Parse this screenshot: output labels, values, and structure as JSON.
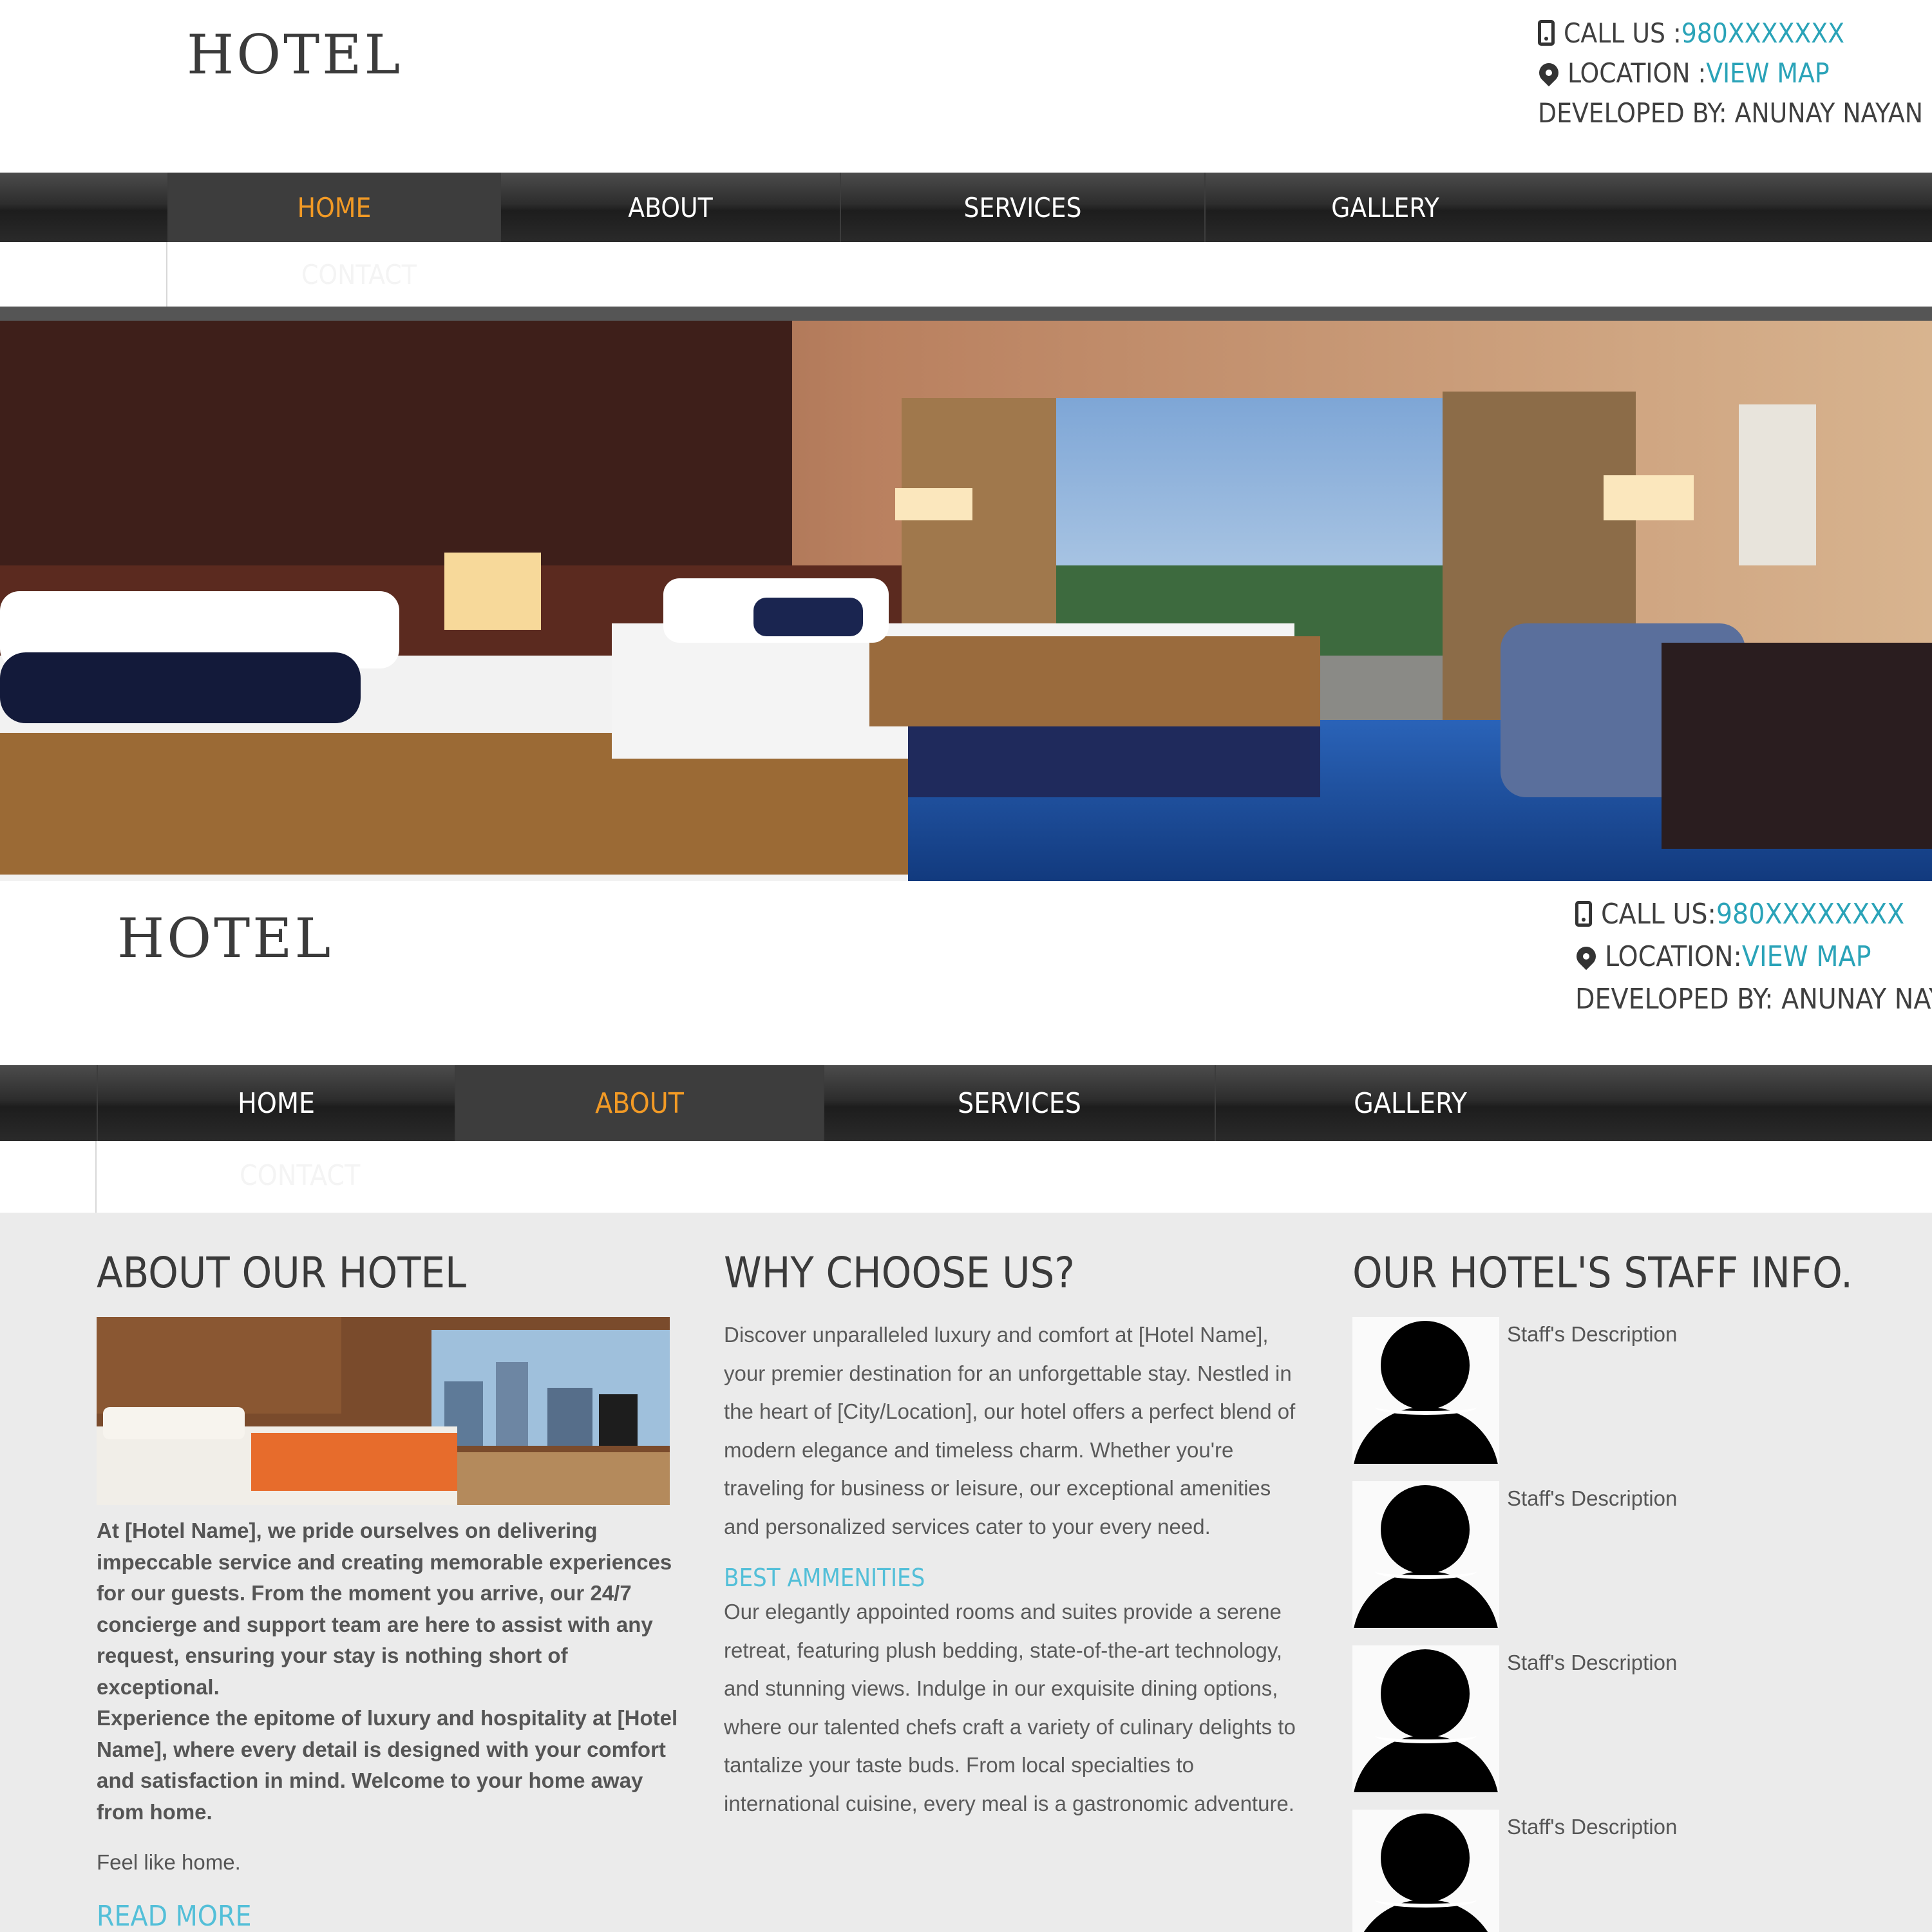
{
  "header": {
    "logo": "HOTEL",
    "call_label": "CALL US : ",
    "call_number": "980XXXXXXX",
    "location_label": "LOCATION : ",
    "location_link": "VIEW MAP",
    "developer": "DEVELOPED BY: ANUNAY NAYAN"
  },
  "header2": {
    "logo": "HOTEL",
    "call_label": "CALL US: ",
    "call_number": "980XXXXXXXX",
    "location_label": "LOCATION: ",
    "location_link": "VIEW MAP",
    "developer": "DEVELOPED BY: ANUNAY NAYAN"
  },
  "nav": {
    "items": [
      "HOME",
      "ABOUT",
      "SERVICES",
      "GALLERY"
    ],
    "overflow_item": "CONTACT",
    "active_first": "HOME",
    "active_second": "ABOUT"
  },
  "about": {
    "title": "ABOUT OUR HOTEL",
    "paragraph1": "At [Hotel Name], we pride ourselves on delivering impeccable service and creating memorable experiences for our guests. From the moment you arrive, our 24/7 concierge and support team are here to assist with any request, ensuring your stay is nothing short of exceptional.",
    "paragraph2": "Experience the epitome of luxury and hospitality at [Hotel Name], where every detail is designed with your comfort and satisfaction in mind. Welcome to your home away from home.",
    "tagline": "Feel like home.",
    "read_more": "READ MORE"
  },
  "why": {
    "title": "WHY CHOOSE US?",
    "paragraph": "Discover unparalleled luxury and comfort at [Hotel Name], your premier destination for an unforgettable stay. Nestled in the heart of [City/Location], our hotel offers a perfect blend of modern elegance and timeless charm. Whether you're traveling for business or leisure, our exceptional amenities and personalized services cater to your every need.",
    "subheading": "BEST AMMENITIES",
    "paragraph2": "Our elegantly appointed rooms and suites provide a serene retreat, featuring plush bedding, state-of-the-art technology, and stunning views. Indulge in our exquisite dining options, where our talented chefs craft a variety of culinary delights to tantalize your taste buds. From local specialties to international cuisine, every meal is a gastronomic adventure."
  },
  "staff": {
    "title": "OUR HOTEL'S STAFF INFO.",
    "members": [
      {
        "description": "Staff's Description"
      },
      {
        "description": "Staff's Description"
      },
      {
        "description": "Staff's Description"
      },
      {
        "description": "Staff's Description"
      }
    ]
  },
  "colors": {
    "accent_link": "#2aa3b8",
    "active_nav": "#f29a25",
    "subheading": "#53bfd8"
  }
}
